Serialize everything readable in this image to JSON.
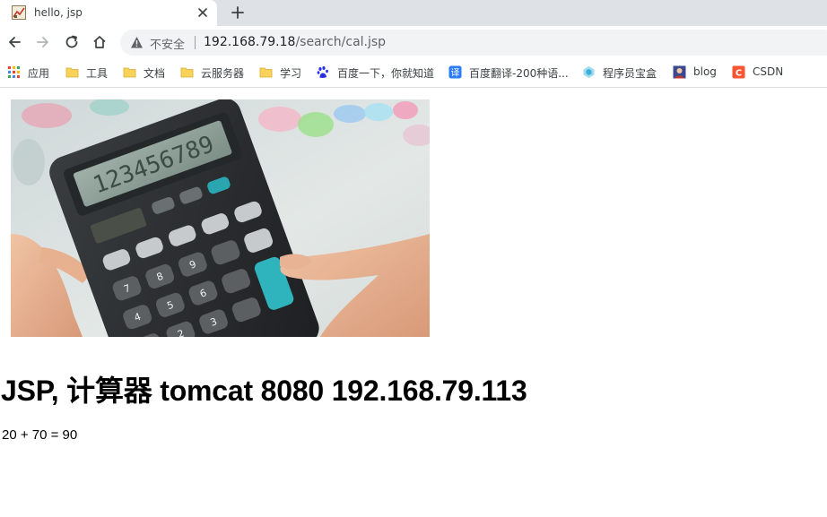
{
  "browser": {
    "tab": {
      "title": "hello, jsp",
      "favicon": "calculator-favicon-icon",
      "close_icon": "close-icon"
    },
    "new_tab_icon": "plus-icon",
    "toolbar": {
      "back_icon": "back-arrow-icon",
      "forward_icon": "forward-arrow-icon",
      "reload_icon": "reload-icon",
      "home_icon": "home-icon"
    },
    "omnibox": {
      "security_icon": "warning-triangle-icon",
      "security_label": "不安全",
      "url_host": "192.168.79.18",
      "url_path": "/search/cal.jsp"
    },
    "bookmarks": [
      {
        "label": "应用",
        "icon": "apps-grid-icon"
      },
      {
        "label": "工具",
        "icon": "folder-icon"
      },
      {
        "label": "文档",
        "icon": "folder-icon"
      },
      {
        "label": "云服务器",
        "icon": "folder-icon"
      },
      {
        "label": "学习",
        "icon": "folder-icon"
      },
      {
        "label": "百度一下，你就知道",
        "icon": "baidu-paw-icon"
      },
      {
        "label": "百度翻译-200种语...",
        "icon": "baidu-translate-icon"
      },
      {
        "label": "程序员宝盒",
        "icon": "coder-box-icon"
      },
      {
        "label": "blog",
        "icon": "blog-avatar-icon"
      },
      {
        "label": "CSDN",
        "icon": "csdn-icon"
      }
    ]
  },
  "colors": {
    "tabstrip": "#dee1e6",
    "omnibox": "#f1f3f4",
    "folder": "#f9d25b",
    "csdn": "#fc5531",
    "translate": "#2b7cf6"
  },
  "page": {
    "image": "calculator-photo",
    "heading": "JSP, 计算器 tomcat 8080 192.168.79.113",
    "result": "20 + 70 = 90"
  }
}
